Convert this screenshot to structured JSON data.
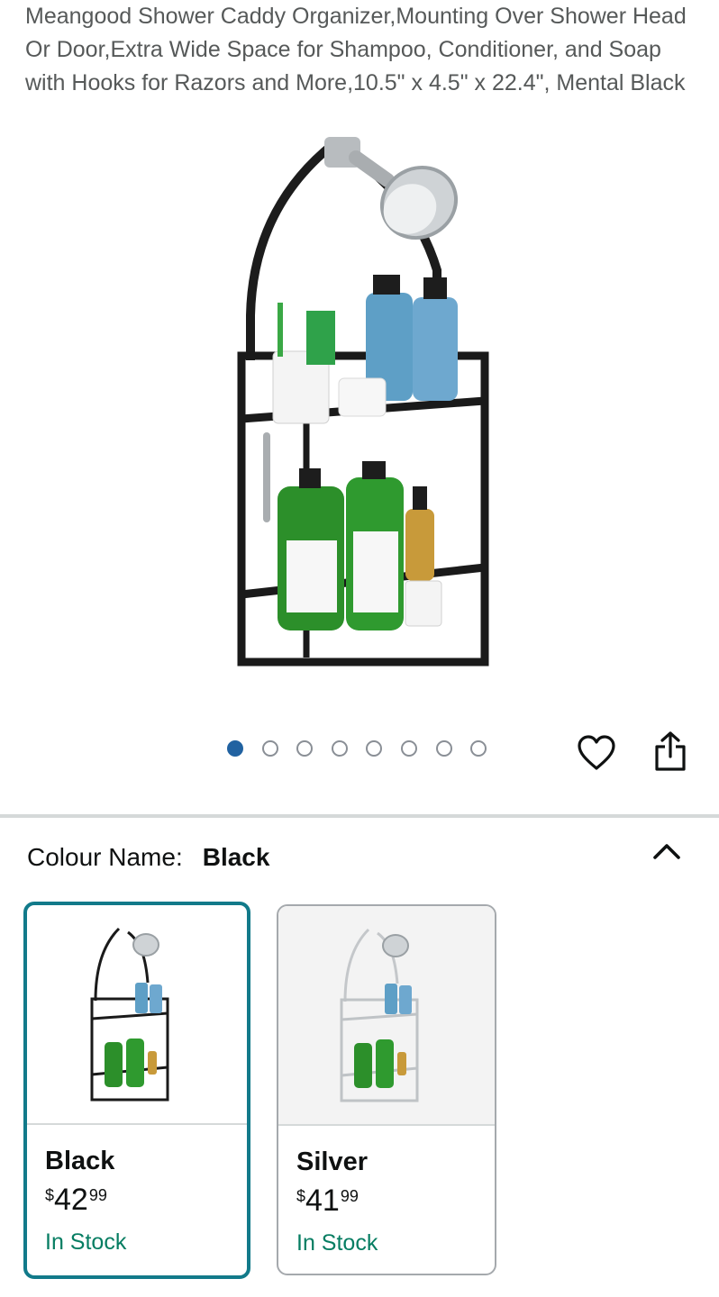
{
  "product": {
    "title": "Meangood Shower Caddy Organizer,Mounting Over Shower Head Or Door,Extra Wide Space for Shampoo, Conditioner, and Soap with Hooks for Razors and More,10.5\" x 4.5\" x 22.4\", Mental Black"
  },
  "gallery": {
    "image_count": 8,
    "active_index": 0
  },
  "actions": {
    "wishlist_icon": "heart-icon",
    "share_icon": "share-icon"
  },
  "variation": {
    "label": "Colour Name:",
    "selected_value": "Black",
    "options": [
      {
        "name": "Black",
        "currency": "$",
        "price_whole": "42",
        "price_fraction": "99",
        "availability": "In Stock"
      },
      {
        "name": "Silver",
        "currency": "$",
        "price_whole": "41",
        "price_fraction": "99",
        "availability": "In Stock"
      }
    ]
  },
  "colors": {
    "accent_selected_border": "#127a8a",
    "active_dot": "#2162a1",
    "in_stock": "#067d62"
  }
}
